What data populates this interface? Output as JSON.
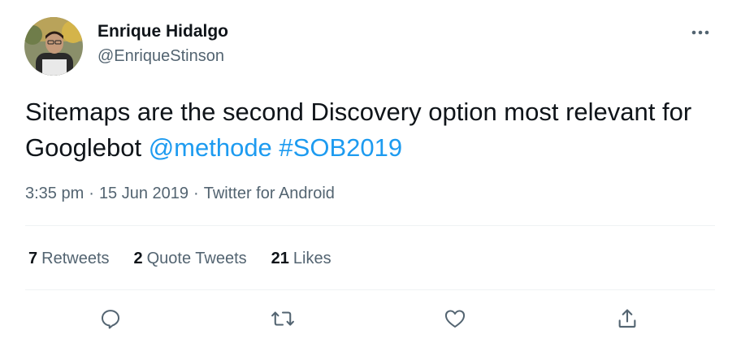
{
  "author": {
    "name": "Enrique Hidalgo",
    "handle": "@EnriqueStinson"
  },
  "tweet": {
    "text": "Sitemaps are the second Discovery option most relevant for Googlebot",
    "mention": "@methode",
    "hashtag": "#SOB2019"
  },
  "meta": {
    "time": "3:35 pm",
    "date": "15 Jun 2019",
    "source": "Twitter for Android",
    "separator": "·"
  },
  "stats": {
    "retweets_count": "7",
    "retweets_label": "Retweets",
    "quote_count": "2",
    "quote_label": "Quote Tweets",
    "likes_count": "21",
    "likes_label": "Likes"
  },
  "colors": {
    "link": "#1d9bf0",
    "secondary_text": "#536471",
    "primary_text": "#0f1419",
    "divider": "#eff3f4"
  },
  "icons": [
    "more-icon",
    "reply-icon",
    "retweet-icon",
    "like-icon",
    "share-icon"
  ]
}
